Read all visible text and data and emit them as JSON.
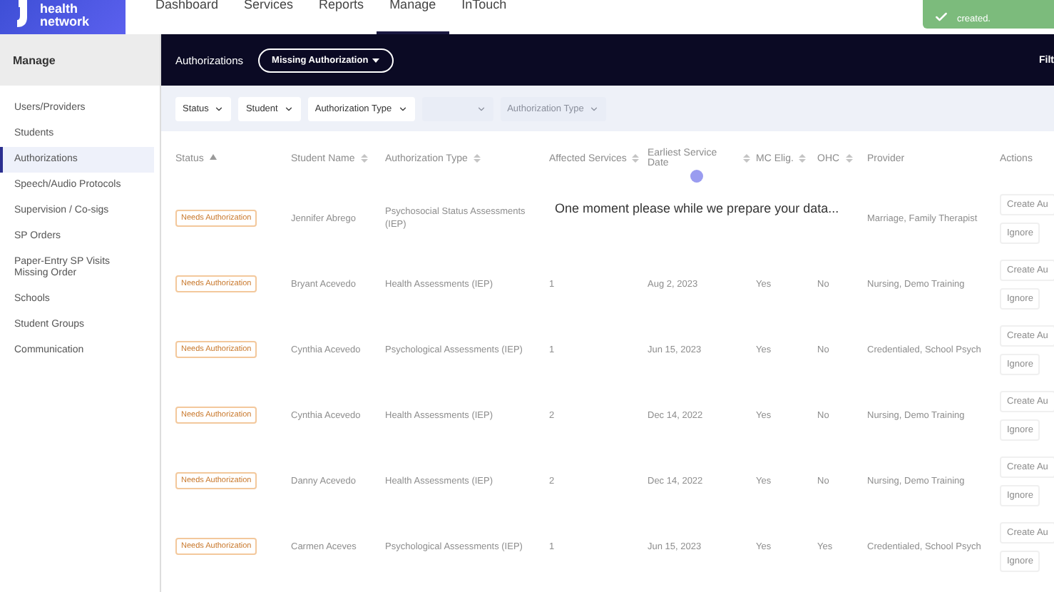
{
  "brand": {
    "name": "health network"
  },
  "nav": [
    {
      "label": "Dashboard",
      "selected": false
    },
    {
      "label": "Services",
      "selected": false
    },
    {
      "label": "Reports",
      "selected": false
    },
    {
      "label": "Manage",
      "selected": true
    },
    {
      "label": "InTouch",
      "selected": false
    }
  ],
  "toast": {
    "message": "created."
  },
  "sidebar": {
    "title": "Manage",
    "items": [
      {
        "label": "Users/Providers",
        "selected": false
      },
      {
        "label": "Students",
        "selected": false
      },
      {
        "label": "Authorizations",
        "selected": true
      },
      {
        "label": "Speech/Audio Protocols",
        "selected": false
      },
      {
        "label": "Supervision / Co-sigs",
        "selected": false
      },
      {
        "label": "SP Orders",
        "selected": false
      },
      {
        "label": "Paper-Entry SP Visits Missing Order",
        "selected": false
      },
      {
        "label": "Schools",
        "selected": false
      },
      {
        "label": "Student Groups",
        "selected": false
      },
      {
        "label": "Communication",
        "selected": false
      }
    ]
  },
  "subheader": {
    "title": "Authorizations",
    "view_button": "Missing Authorization",
    "filter_label": "Filt"
  },
  "filters": [
    {
      "kind": "active",
      "label": "Status"
    },
    {
      "kind": "active",
      "label": "Student"
    },
    {
      "kind": "active",
      "label": "Authorization Type"
    },
    {
      "kind": "faded"
    },
    {
      "kind": "faded",
      "label": "Authorization Type"
    }
  ],
  "table": {
    "columns": [
      {
        "label": "Status",
        "sorted": true
      },
      {
        "label": "Student Name",
        "sorted": false
      },
      {
        "label": "Authorization Type",
        "sorted": false
      },
      {
        "label": "Affected Services",
        "sorted": false
      },
      {
        "label": "Earliest Service Date",
        "sorted": false
      },
      {
        "label": "MC Elig.",
        "sorted": false
      },
      {
        "label": "OHC",
        "sorted": false
      },
      {
        "label": "Provider"
      },
      {
        "label": "Actions"
      }
    ],
    "rows": [
      {
        "status": "Needs Authorization",
        "student": "Jennifer Abrego",
        "auth_type": "Psychosocial Status Assessments (IEP)",
        "provider": "Marriage, Family Therapist",
        "actions": [
          "Create Au",
          "Ignore"
        ]
      },
      {
        "status": "Needs Authorization",
        "student": "Bryant Acevedo",
        "auth_type": "Health Assessments (IEP)",
        "affected": "1",
        "date": "Aug 2, 2023",
        "mc": "Yes",
        "ohc": "No",
        "provider": "Nursing, Demo Training",
        "actions": [
          "Create Au",
          "Ignore"
        ]
      },
      {
        "status": "Needs Authorization",
        "student": "Cynthia Acevedo",
        "auth_type": "Psychological Assessments (IEP)",
        "affected": "1",
        "date": "Jun 15, 2023",
        "mc": "Yes",
        "ohc": "No",
        "provider": "Credentialed, School Psych",
        "actions": [
          "Create Au",
          "Ignore"
        ]
      },
      {
        "status": "Needs Authorization",
        "student": "Cynthia Acevedo",
        "auth_type": "Health Assessments (IEP)",
        "affected": "2",
        "date": "Dec 14, 2022",
        "mc": "Yes",
        "ohc": "No",
        "provider": "Nursing, Demo Training",
        "actions": [
          "Create Au",
          "Ignore"
        ]
      },
      {
        "status": "Needs Authorization",
        "student": "Danny Acevedo",
        "auth_type": "Health Assessments (IEP)",
        "affected": "2",
        "date": "Dec 14, 2022",
        "mc": "Yes",
        "ohc": "No",
        "provider": "Nursing, Demo Training",
        "actions": [
          "Create Au",
          "Ignore"
        ]
      },
      {
        "status": "Needs Authorization",
        "student": "Carmen Aceves",
        "auth_type": "Psychological Assessments (IEP)",
        "affected": "1",
        "date": "Jun 15, 2023",
        "mc": "Yes",
        "ohc": "Yes",
        "provider": "Credentialed, School Psych",
        "actions": [
          "Create Au",
          "Ignore"
        ]
      }
    ]
  },
  "loading": {
    "message": "One moment please while we prepare your data..."
  }
}
